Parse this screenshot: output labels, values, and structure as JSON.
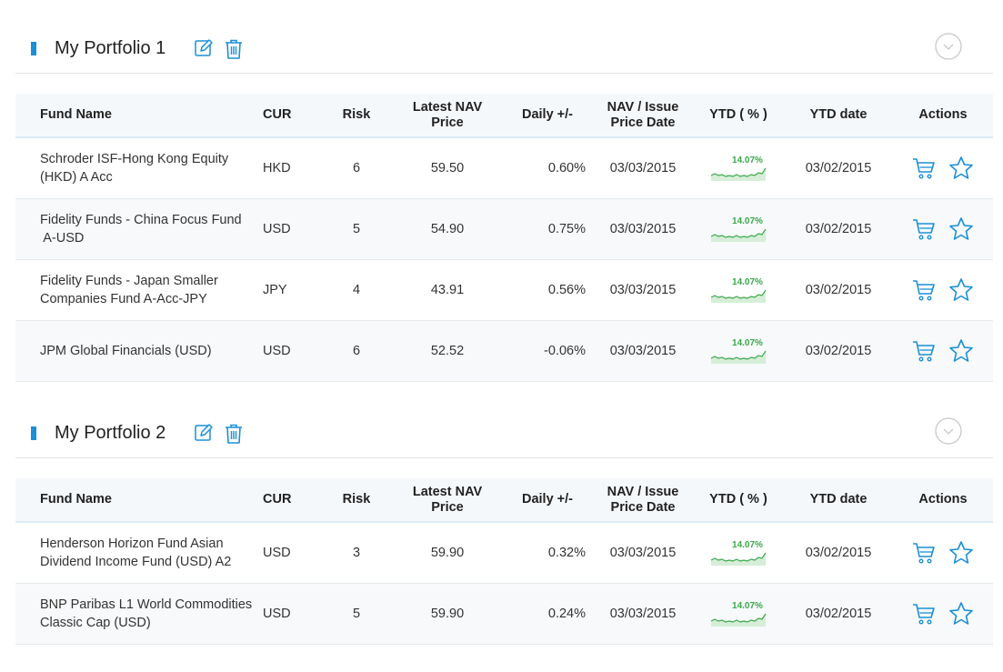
{
  "columns": {
    "fund_name": "Fund Name",
    "cur": "CUR",
    "risk": "Risk",
    "nav_line1": "Latest NAV",
    "nav_line2": "Price",
    "daily": "Daily +/-",
    "navdate_line1": "NAV / Issue",
    "navdate_line2": "Price Date",
    "ytd": "YTD ( % )",
    "ytd_date": "YTD date",
    "actions": "Actions"
  },
  "colors": {
    "accent": "#1a8fd8",
    "spark_line": "#3aa84a",
    "spark_fill": "#d6eed8"
  },
  "icons": {
    "edit": "edit-icon",
    "delete": "trash-icon",
    "toggle": "chevron-down-circle-icon",
    "buy": "cart-icon",
    "watch": "star-icon"
  },
  "portfolios": [
    {
      "title": "My Portfolio 1",
      "funds": [
        {
          "name_line1": "Schroder ISF-Hong Kong Equity",
          "name_line2": "(HKD) A Acc",
          "cur": "HKD",
          "risk": "6",
          "nav": "59.50",
          "daily": "0.60%",
          "nav_date": "03/03/2015",
          "ytd": "14.07%",
          "ytd_date": "03/02/2015"
        },
        {
          "name_line1": "Fidelity Funds - China Focus Fund",
          "name_line2": " A-USD",
          "cur": "USD",
          "risk": "5",
          "nav": "54.90",
          "daily": "0.75%",
          "nav_date": "03/03/2015",
          "ytd": "14.07%",
          "ytd_date": "03/02/2015"
        },
        {
          "name_line1": "Fidelity Funds - Japan Smaller",
          "name_line2": "Companies Fund A-Acc-JPY",
          "cur": "JPY",
          "risk": "4",
          "nav": "43.91",
          "daily": "0.56%",
          "nav_date": "03/03/2015",
          "ytd": "14.07%",
          "ytd_date": "03/02/2015"
        },
        {
          "name_line1": "JPM Global Financials (USD)",
          "name_line2": "",
          "cur": "USD",
          "risk": "6",
          "nav": "52.52",
          "daily": "-0.06%",
          "nav_date": "03/03/2015",
          "ytd": "14.07%",
          "ytd_date": "03/02/2015"
        }
      ]
    },
    {
      "title": "My Portfolio 2",
      "funds": [
        {
          "name_line1": "Henderson Horizon Fund Asian",
          "name_line2": "Dividend Income Fund (USD) A2",
          "cur": "USD",
          "risk": "3",
          "nav": "59.90",
          "daily": "0.32%",
          "nav_date": "03/03/2015",
          "ytd": "14.07%",
          "ytd_date": "03/02/2015"
        },
        {
          "name_line1": "BNP Paribas L1 World Commodities",
          "name_line2": "Classic Cap (USD)",
          "cur": "USD",
          "risk": "5",
          "nav": "59.90",
          "daily": "0.24%",
          "nav_date": "03/03/2015",
          "ytd": "14.07%",
          "ytd_date": "03/02/2015"
        }
      ]
    }
  ]
}
